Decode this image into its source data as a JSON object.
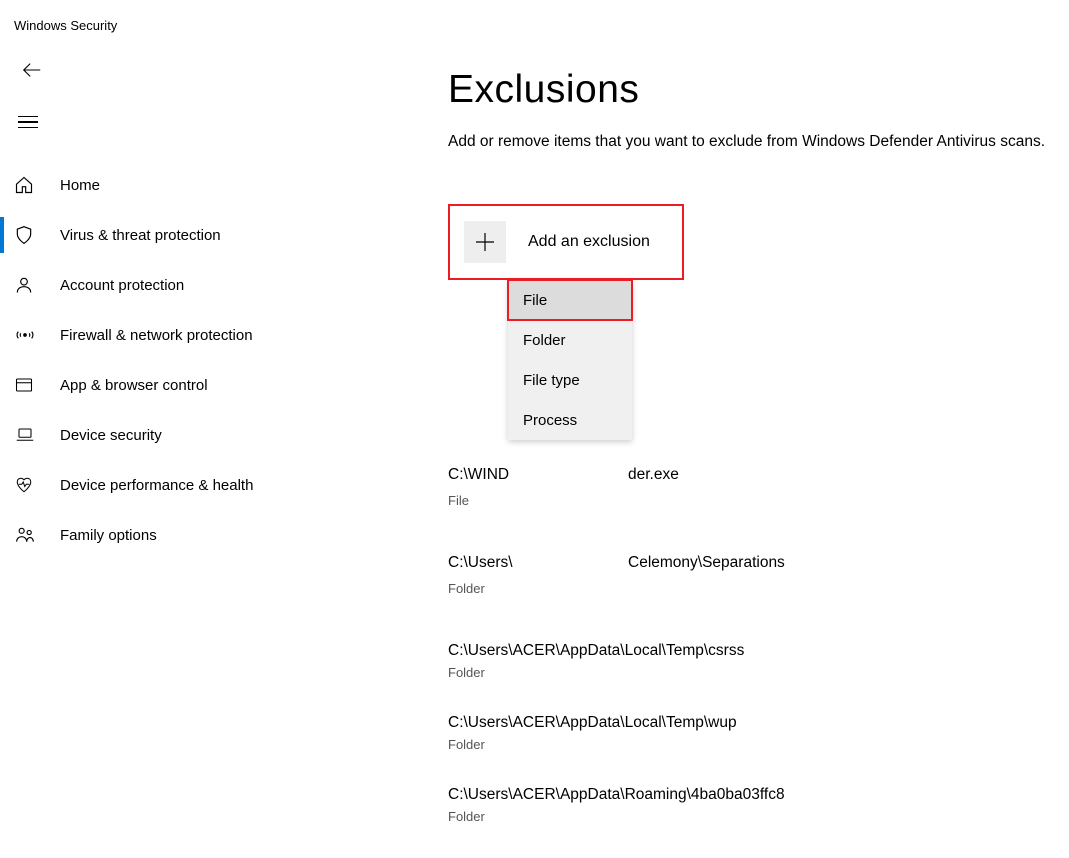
{
  "app_title": "Windows Security",
  "sidebar": {
    "items": [
      {
        "label": "Home"
      },
      {
        "label": "Virus & threat protection"
      },
      {
        "label": "Account protection"
      },
      {
        "label": "Firewall & network protection"
      },
      {
        "label": "App & browser control"
      },
      {
        "label": "Device security"
      },
      {
        "label": "Device performance & health"
      },
      {
        "label": "Family options"
      }
    ]
  },
  "page": {
    "title": "Exclusions",
    "description": "Add or remove items that you want to exclude from Windows Defender Antivirus scans.",
    "add_label": "Add an exclusion"
  },
  "menu": {
    "items": [
      {
        "label": "File"
      },
      {
        "label": "Folder"
      },
      {
        "label": "File type"
      },
      {
        "label": "Process"
      }
    ]
  },
  "exclusions": [
    {
      "partial_path_left": "C:\\WIND",
      "partial_path_right": "der.exe",
      "type": "File"
    },
    {
      "partial_path_left": "C:\\Users\\",
      "partial_path_right": "Celemony\\Separations",
      "type": "Folder"
    },
    {
      "path": "C:\\Users\\ACER\\AppData\\Local\\Temp\\csrss",
      "type": "Folder"
    },
    {
      "path": "C:\\Users\\ACER\\AppData\\Local\\Temp\\wup",
      "type": "Folder"
    },
    {
      "path": "C:\\Users\\ACER\\AppData\\Roaming\\4ba0ba03ffc8",
      "type": "Folder"
    }
  ]
}
